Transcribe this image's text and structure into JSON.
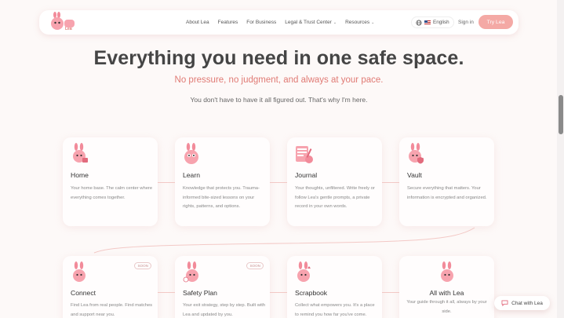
{
  "nav": {
    "logo_text": "Lea",
    "links": [
      {
        "label": "About Lea",
        "has_menu": false
      },
      {
        "label": "Features",
        "has_menu": false
      },
      {
        "label": "For Business",
        "has_menu": false
      },
      {
        "label": "Legal & Trust Center",
        "has_menu": true
      },
      {
        "label": "Resources",
        "has_menu": true
      }
    ],
    "language": "English",
    "signin": "Sign in",
    "cta": "Try Lea"
  },
  "hero": {
    "title": "Everything you need in one safe space.",
    "subtitle": "No pressure, no judgment, and always at your pace.",
    "description": "You don't have to have it all figured out. That's why I'm here."
  },
  "cards": [
    {
      "title": "Home",
      "desc": "Your home base. The calm center where everything comes together.",
      "soon": ""
    },
    {
      "title": "Learn",
      "desc": "Knowledge that protects you. Trauma-informed bite-sized lessons on your rights, patterns, and options.",
      "soon": ""
    },
    {
      "title": "Journal",
      "desc": "Your thoughts, unfiltered. Write freely or follow Lea's gentle prompts, a private record in your own words.",
      "soon": ""
    },
    {
      "title": "Vault",
      "desc": "Secure everything that matters. Your information is encrypted and organized.",
      "soon": ""
    },
    {
      "title": "Connect",
      "desc": "Find Lea from real people. Find matches and support near you.",
      "soon": "SOON"
    },
    {
      "title": "Safety Plan",
      "desc": "Your exit strategy, step by step. Built with Lea and updated by you.",
      "soon": "SOON"
    },
    {
      "title": "Scrapbook",
      "desc": "Collect what empowers you. It's a place to remind you how far you've come.",
      "soon": ""
    },
    {
      "title": "All with Lea",
      "desc": "Your guide through it all, always by your side.",
      "soon": ""
    }
  ],
  "chat": {
    "label": "Chat with Lea"
  },
  "colors": {
    "accent": "#f4a9a5",
    "subtitle": "#e07a74",
    "bunny": "#f28b9a"
  }
}
